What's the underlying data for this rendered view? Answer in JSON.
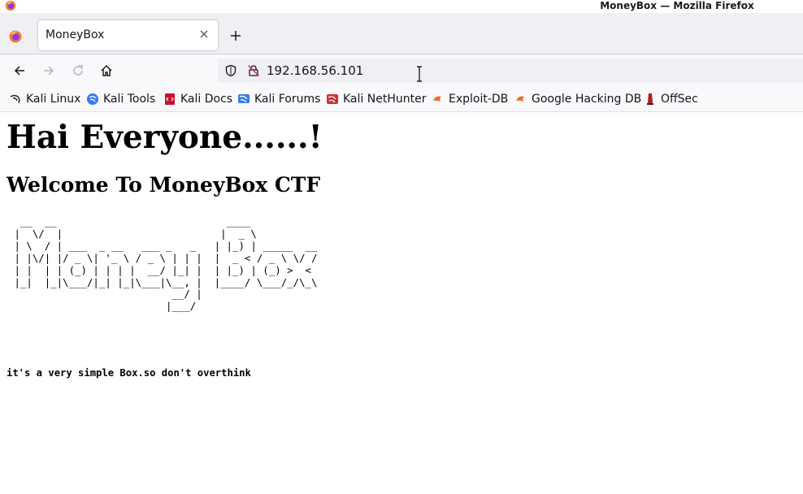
{
  "window": {
    "title": "MoneyBox — Mozilla Firefox"
  },
  "tabs": [
    {
      "label": "MoneyBox",
      "active": true
    }
  ],
  "navbar": {
    "url": "192.168.56.101"
  },
  "bookmarks": [
    {
      "label": "Kali Linux",
      "icon": "kali-dragon-icon"
    },
    {
      "label": "Kali Tools",
      "icon": "kali-tools-icon"
    },
    {
      "label": "Kali Docs",
      "icon": "kali-docs-icon"
    },
    {
      "label": "Kali Forums",
      "icon": "kali-forums-icon"
    },
    {
      "label": "Kali NetHunter",
      "icon": "kali-nethunter-icon"
    },
    {
      "label": "Exploit-DB",
      "icon": "exploit-db-icon"
    },
    {
      "label": "Google Hacking DB",
      "icon": "ghdb-icon"
    },
    {
      "label": "OffSec",
      "icon": "offsec-icon"
    }
  ],
  "page": {
    "heading": "Hai Everyone......!",
    "subheading": "Welcome To MoneyBox CTF",
    "ascii_art": "  __  __                            ____\n |  \\/  |                          |  _ \\\n | \\  / | ___  _ __   ___ _   _   | |_) | _____  __\n | |\\/| |/ _ \\| '_ \\ / _ \\ | | |  |  _ < / _ \\ \\/ /\n | |  | | (_) | | | |  __/ |_| |  | |_) | (_) >  <\n |_|  |_|\\___/|_| |_|\\___|\\__, |  |____/ \\___/_/\\_\\\n                           __/ |\n                          |___/",
    "note": "it's a very simple Box.so don't overthink"
  },
  "colors": {
    "tabstrip_bg": "#f0f0f4",
    "toolbar_bg": "#f9f9fb",
    "urlbar_bg": "#f0f0f4"
  }
}
